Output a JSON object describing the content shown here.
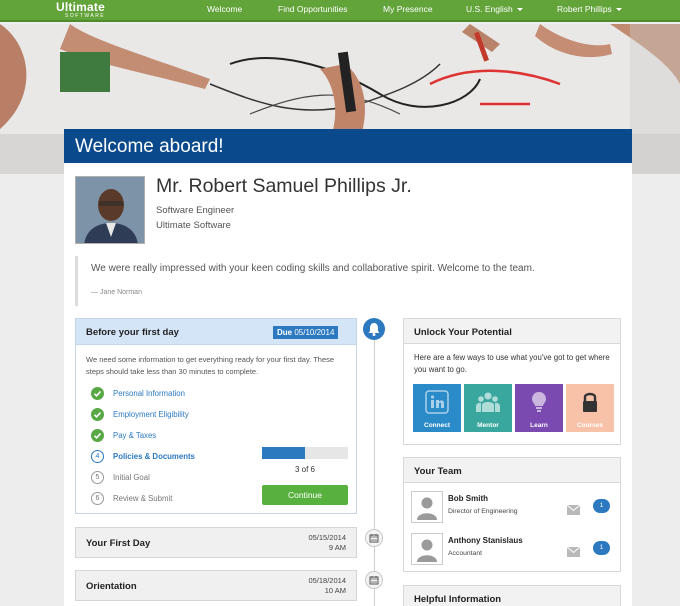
{
  "nav": {
    "logo_line1": "Ultimate",
    "logo_line2": "SOFTWARE",
    "items": [
      "Welcome",
      "Find Opportunities",
      "My Presence",
      "U.S. English",
      "Robert Phillips"
    ]
  },
  "banner": {
    "title": "Welcome aboard!"
  },
  "profile": {
    "name": "Mr. Robert Samuel Phillips Jr.",
    "role": "Software Engineer",
    "company": "Ultimate Software"
  },
  "quote": {
    "text": "We were really impressed with your keen coding skills and collaborative spirit. Welcome to the team.",
    "author": "— Jane Norman"
  },
  "before_first_day": {
    "title": "Before your first day",
    "due_label": "Due",
    "due_date": "05/10/2014",
    "description": "We need some information to get everything ready for your first day. These steps should take less than 30 minutes to complete.",
    "steps": [
      {
        "label": "Personal Information",
        "state": "done"
      },
      {
        "label": "Employment Eligibility",
        "state": "done"
      },
      {
        "label": "Pay & Taxes",
        "state": "done"
      },
      {
        "label": "Policies & Documents",
        "state": "current",
        "number": "4"
      },
      {
        "label": "Initial Goal",
        "state": "todo",
        "number": "5"
      },
      {
        "label": "Review & Submit",
        "state": "todo",
        "number": "6"
      }
    ],
    "progress_text": "3 of 6",
    "progress_fraction": 0.5,
    "continue_label": "Continue"
  },
  "events": [
    {
      "title": "Your First Day",
      "date": "05/15/2014",
      "time": "9 AM"
    },
    {
      "title": "Orientation",
      "date": "05/18/2014",
      "time": "10 AM"
    }
  ],
  "unlock": {
    "title": "Unlock Your Potential",
    "description": "Here are a few ways to use what you've got to get where you want to go.",
    "tiles": [
      {
        "label": "Connect",
        "color": "#2b8bc9",
        "icon": "linkedin-icon"
      },
      {
        "label": "Mentor",
        "color": "#3aa79e",
        "icon": "people-icon"
      },
      {
        "label": "Learn",
        "color": "#7a4ab0",
        "icon": "lightbulb-icon"
      },
      {
        "label": "Courses",
        "color": "#f8c2a8",
        "icon": "lock-icon"
      }
    ]
  },
  "team": {
    "title": "Your Team",
    "members": [
      {
        "name": "Bob Smith",
        "role": "Director of Engineering",
        "messages": "1"
      },
      {
        "name": "Anthony Stanislaus",
        "role": "Accountant",
        "messages": "1"
      }
    ]
  },
  "helpful": {
    "title": "Helpful Information"
  },
  "colors": {
    "nav": "#62a33a",
    "banner": "#0a4a8c",
    "accent": "#2c79c0",
    "success": "#58b13e"
  }
}
